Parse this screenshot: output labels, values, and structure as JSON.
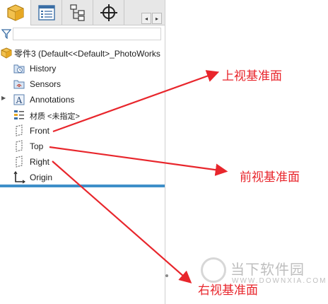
{
  "tabs": [
    {
      "name": "feature-manager",
      "icon": "part-cube-icon"
    },
    {
      "name": "property-manager",
      "icon": "list-icon"
    },
    {
      "name": "configuration-manager",
      "icon": "tree-icon"
    },
    {
      "name": "dimxpert-manager",
      "icon": "crosshair-icon"
    },
    {
      "name": "display-manager",
      "icon": "sphere-icon"
    }
  ],
  "tab_scroll": {
    "left": "◂",
    "right": "▸"
  },
  "filter": {
    "icon": "funnel-icon",
    "placeholder": ""
  },
  "tree": {
    "root": {
      "label": "零件3  (Default<<Default>_PhotoWorks",
      "icon": "part-cube-icon"
    },
    "items": [
      {
        "label": "History",
        "icon": "history-folder-icon",
        "expandable": false
      },
      {
        "label": "Sensors",
        "icon": "sensors-folder-icon",
        "expandable": false
      },
      {
        "label": "Annotations",
        "icon": "annotations-icon",
        "expandable": true
      },
      {
        "label": "材质 <未指定>",
        "icon": "material-icon",
        "expandable": false
      },
      {
        "label": "Front",
        "icon": "plane-icon",
        "expandable": false
      },
      {
        "label": "Top",
        "icon": "plane-icon",
        "expandable": false
      },
      {
        "label": "Right",
        "icon": "plane-icon",
        "expandable": false
      },
      {
        "label": "Origin",
        "icon": "origin-icon",
        "expandable": false
      }
    ]
  },
  "annotations": {
    "top_plane": "上视基准面",
    "front_plane": "前视基准面",
    "right_plane": "右视基准面",
    "color": "#e8262c"
  },
  "watermark": {
    "cn": "当下软件园",
    "en": "WWW.DOWNXIA.COM"
  },
  "colors": {
    "rollback_bar": "#3e8fc9",
    "accent_yellow": "#e7a823",
    "arrow": "#e8262c"
  }
}
